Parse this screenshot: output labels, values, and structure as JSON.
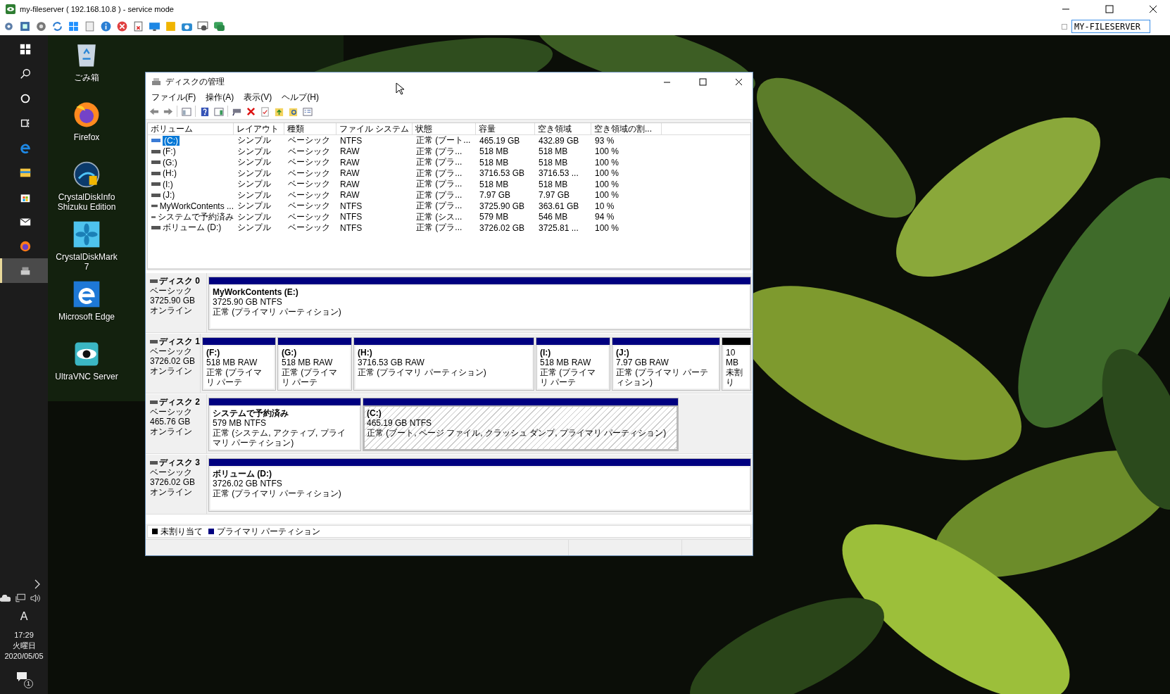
{
  "remote_window": {
    "title": "my-fileserver ( 192.168.10.8 ) - service mode",
    "hostname_field": {
      "value": "MY-FILESERVER"
    }
  },
  "taskbar": {
    "apps": [
      {
        "selected": false
      },
      {
        "selected": false
      },
      {
        "selected": false
      },
      {
        "selected": false
      },
      {
        "selected": false
      },
      {
        "selected": false
      },
      {
        "selected": false
      },
      {
        "selected": false
      },
      {
        "selected": false
      },
      {
        "selected": true
      }
    ],
    "input_indicator": "A",
    "clock": {
      "time": "17:29",
      "day": "火曜日",
      "date": "2020/05/05"
    },
    "notification_count": "1"
  },
  "desktop_icons": [
    {
      "label": "ごみ箱"
    },
    {
      "label": "Firefox"
    },
    {
      "label": "CrystalDiskInfo Shizuku Edition"
    },
    {
      "label": "CrystalDiskMark 7"
    },
    {
      "label": "Microsoft Edge"
    },
    {
      "label": "UltraVNC Server"
    }
  ],
  "window": {
    "title": "ディスクの管理",
    "menu": [
      "ファイル(F)",
      "操作(A)",
      "表示(V)",
      "ヘルプ(H)"
    ],
    "volumes": {
      "columns": [
        "ボリューム",
        "レイアウト",
        "種類",
        "ファイル システム",
        "状態",
        "容量",
        "空き領域",
        "空き領域の割..."
      ],
      "rows": [
        {
          "selected": true,
          "cells": [
            "(C:)",
            "シンプル",
            "ベーシック",
            "NTFS",
            "正常 (ブート...",
            "465.19 GB",
            "432.89 GB",
            "93 %"
          ]
        },
        {
          "selected": false,
          "cells": [
            "(F:)",
            "シンプル",
            "ベーシック",
            "RAW",
            "正常 (プラ...",
            "518 MB",
            "518 MB",
            "100 %"
          ]
        },
        {
          "selected": false,
          "cells": [
            "(G:)",
            "シンプル",
            "ベーシック",
            "RAW",
            "正常 (プラ...",
            "518 MB",
            "518 MB",
            "100 %"
          ]
        },
        {
          "selected": false,
          "cells": [
            "(H:)",
            "シンプル",
            "ベーシック",
            "RAW",
            "正常 (プラ...",
            "3716.53 GB",
            "3716.53 ...",
            "100 %"
          ]
        },
        {
          "selected": false,
          "cells": [
            "(I:)",
            "シンプル",
            "ベーシック",
            "RAW",
            "正常 (プラ...",
            "518 MB",
            "518 MB",
            "100 %"
          ]
        },
        {
          "selected": false,
          "cells": [
            "(J:)",
            "シンプル",
            "ベーシック",
            "RAW",
            "正常 (プラ...",
            "7.97 GB",
            "7.97 GB",
            "100 %"
          ]
        },
        {
          "selected": false,
          "cells": [
            "MyWorkContents ...",
            "シンプル",
            "ベーシック",
            "NTFS",
            "正常 (プラ...",
            "3725.90 GB",
            "363.61 GB",
            "10 %"
          ]
        },
        {
          "selected": false,
          "cells": [
            "システムで予約済み",
            "シンプル",
            "ベーシック",
            "NTFS",
            "正常 (シス...",
            "579 MB",
            "546 MB",
            "94 %"
          ]
        },
        {
          "selected": false,
          "cells": [
            "ボリューム (D:)",
            "シンプル",
            "ベーシック",
            "NTFS",
            "正常 (プラ...",
            "3726.02 GB",
            "3725.81 ...",
            "100 %"
          ]
        }
      ]
    },
    "disks": [
      {
        "name": "ディスク 0",
        "type": "ベーシック",
        "size": "3725.90 GB",
        "status": "オンライン",
        "partitions": [
          {
            "kind": "primary",
            "selected": false,
            "name": "MyWorkContents  (E:)",
            "size": "3725.90 GB NTFS",
            "status": "正常 (プライマリ パーティション)"
          }
        ]
      },
      {
        "name": "ディスク 1",
        "type": "ベーシック",
        "size": "3726.02 GB",
        "status": "オンライン",
        "partitions": [
          {
            "kind": "primary",
            "selected": false,
            "name": "(F:)",
            "size": "518 MB RAW",
            "status": "正常 (プライマリ パーテ"
          },
          {
            "kind": "primary",
            "selected": false,
            "name": "(G:)",
            "size": "518 MB RAW",
            "status": "正常 (プライマリ パーテ"
          },
          {
            "kind": "primary",
            "selected": false,
            "name": "(H:)",
            "size": "3716.53 GB RAW",
            "status": "正常 (プライマリ パーティション)"
          },
          {
            "kind": "primary",
            "selected": false,
            "name": "(I:)",
            "size": "518 MB RAW",
            "status": "正常 (プライマリ パーテ"
          },
          {
            "kind": "primary",
            "selected": false,
            "name": "(J:)",
            "size": "7.97 GB RAW",
            "status": "正常 (プライマリ パーティション)"
          },
          {
            "kind": "unallocated",
            "selected": false,
            "size": "10 MB",
            "status": "未割り"
          }
        ]
      },
      {
        "name": "ディスク 2",
        "type": "ベーシック",
        "size": "465.76 GB",
        "status": "オンライン",
        "partitions": [
          {
            "kind": "primary",
            "selected": false,
            "name": "システムで予約済み",
            "size": "579 MB NTFS",
            "status": "正常 (システム, アクティブ, プライマリ パーティション)"
          },
          {
            "kind": "primary",
            "selected": true,
            "name": "(C:)",
            "size": "465.19 GB NTFS",
            "status": "正常 (ブート, ページ ファイル, クラッシュ ダンプ, プライマリ パーティション)"
          }
        ]
      },
      {
        "name": "ディスク 3",
        "type": "ベーシック",
        "size": "3726.02 GB",
        "status": "オンライン",
        "partitions": [
          {
            "kind": "primary",
            "selected": false,
            "name": "ボリューム  (D:)",
            "size": "3726.02 GB NTFS",
            "status": "正常 (プライマリ パーティション)"
          }
        ]
      }
    ],
    "legend": [
      {
        "kind": "unallocated",
        "label": "未割り当て"
      },
      {
        "kind": "primary",
        "label": "プライマリ パーティション"
      }
    ]
  }
}
